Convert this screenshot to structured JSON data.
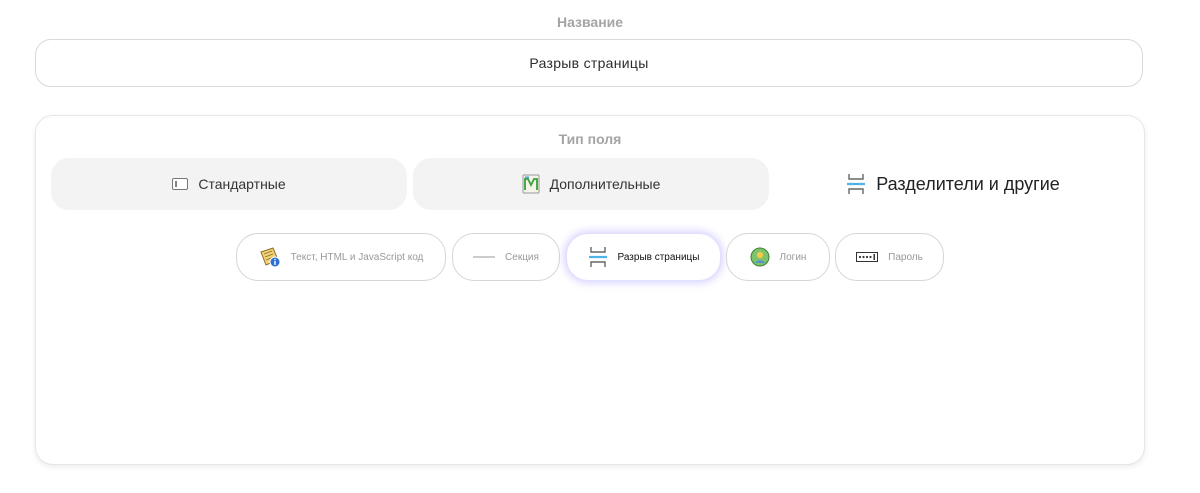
{
  "name_field": {
    "label": "Название",
    "value": "Разрыв страницы"
  },
  "field_type": {
    "label": "Тип поля",
    "categories": [
      {
        "label": "Стандартные",
        "icon": "text-field-icon",
        "state": "inactive"
      },
      {
        "label": "Дополнительные",
        "icon": "additional-fields-icon",
        "state": "inactive"
      },
      {
        "label": "Разделители и другие",
        "icon": "page-break-icon",
        "state": "active"
      }
    ],
    "subtypes": [
      {
        "label": "Текст, HTML и JavaScript код",
        "icon": "text-html-icon",
        "state": "inactive"
      },
      {
        "label": "Секция",
        "icon": "section-line-icon",
        "state": "inactive"
      },
      {
        "label": "Разрыв страницы",
        "icon": "page-break-icon",
        "state": "active"
      },
      {
        "label": "Логин",
        "icon": "login-icon",
        "state": "inactive"
      },
      {
        "label": "Пароль",
        "icon": "password-icon",
        "state": "inactive"
      }
    ]
  },
  "colors": {
    "active_glow": "#8c82ff",
    "page_break_icon": "#4fb3e8",
    "inactive_tab_bg": "#f3f3f3"
  }
}
